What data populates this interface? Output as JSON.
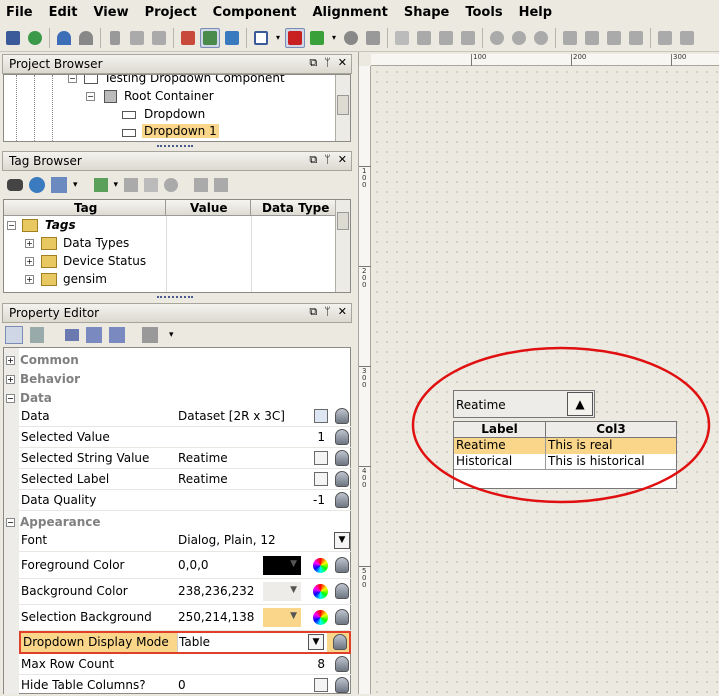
{
  "menu": [
    "File",
    "Edit",
    "View",
    "Project",
    "Component",
    "Alignment",
    "Shape",
    "Tools",
    "Help"
  ],
  "project_browser": {
    "title": "Project Browser",
    "items": [
      {
        "label": "Testing Dropdown Component",
        "icon": "window-icon"
      },
      {
        "label": "Root Container",
        "icon": "container-icon"
      },
      {
        "label": "Dropdown",
        "icon": "dropdown-component-icon"
      },
      {
        "label": "Dropdown 1",
        "icon": "dropdown-component-icon",
        "selected": true
      }
    ]
  },
  "tag_browser": {
    "title": "Tag Browser",
    "columns": [
      "Tag",
      "Value",
      "Data Type"
    ],
    "items": [
      {
        "label": "Tags",
        "icon": "tags-folder-icon"
      },
      {
        "label": "Data Types",
        "icon": "folder-icon"
      },
      {
        "label": "Device Status",
        "icon": "folder-icon"
      },
      {
        "label": "gensim",
        "icon": "folder-icon"
      }
    ]
  },
  "property_editor": {
    "title": "Property Editor",
    "sections": {
      "common": "Common",
      "behavior": "Behavior",
      "data": "Data",
      "appearance": "Appearance"
    },
    "rows": [
      {
        "name": "Data",
        "value": "Dataset [2R x 3C]"
      },
      {
        "name": "Selected Value",
        "value": "1"
      },
      {
        "name": "Selected String Value",
        "value": "Reatime"
      },
      {
        "name": "Selected Label",
        "value": "Reatime"
      },
      {
        "name": "Data Quality",
        "value": "-1"
      },
      {
        "name": "Font",
        "value": "Dialog, Plain, 12"
      },
      {
        "name": "Foreground Color",
        "value": "0,0,0",
        "swatch": "#000000"
      },
      {
        "name": "Background Color",
        "value": "238,236,232",
        "swatch": "#eeece8"
      },
      {
        "name": "Selection Background",
        "value": "250,214,138",
        "swatch": "#fad68a"
      },
      {
        "name": "Dropdown Display Mode",
        "value": "Table"
      },
      {
        "name": "Max Row Count",
        "value": "8"
      },
      {
        "name": "Hide Table Columns?",
        "value": "0"
      }
    ]
  },
  "ruler": {
    "h_labels": [
      "100",
      "200",
      "300"
    ],
    "v_labels": [
      "100",
      "200",
      "300",
      "400",
      "500"
    ]
  },
  "dropdown": {
    "selected": "Reatime",
    "columns": [
      "Label",
      "Col3"
    ],
    "rows": [
      {
        "label": "Reatime",
        "col3": "This is real",
        "selected": true
      },
      {
        "label": "Historical",
        "col3": "This is historical"
      }
    ]
  },
  "colors": {
    "selection": "#fad68a",
    "highlight_box": "#e0402a",
    "annotation_circle": "#e01010"
  }
}
